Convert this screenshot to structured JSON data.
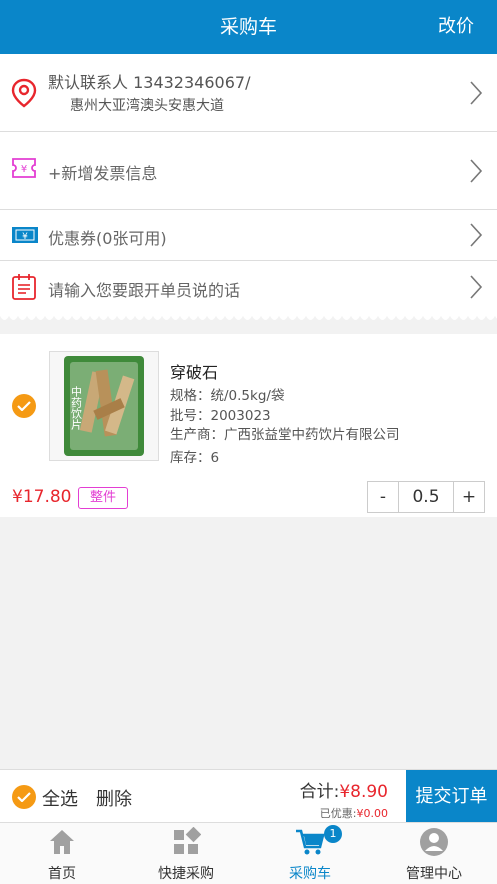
{
  "header": {
    "title": "采购车",
    "action": "改价"
  },
  "address": {
    "contact": "默认联系人 13432346067/",
    "street": "惠州大亚湾澳头安惠大道"
  },
  "invoice": {
    "label": "+新增发票信息"
  },
  "coupon": {
    "label": "优惠券(0张可用)"
  },
  "message": {
    "placeholder": "请输入您要跟开单员说的话"
  },
  "product": {
    "name": "穿破石",
    "spec": "规格：统/0.5kg/袋",
    "batch": "批号：2003023",
    "maker": "生产商：广西张益堂中药饮片有限公司",
    "stock": "库存：6",
    "price": "¥17.80",
    "tag": "整件",
    "qty": "0.5",
    "minus": "-",
    "plus": "+",
    "package_text": "中药饮片"
  },
  "footer": {
    "select_all": "全选",
    "delete": "删除",
    "total_label": "合计:",
    "total_value": "¥8.90",
    "discount_label": "已优惠:",
    "discount_value": "¥0.00",
    "submit": "提交订单"
  },
  "tabs": [
    {
      "label": "首页"
    },
    {
      "label": "快捷采购"
    },
    {
      "label": "采购车",
      "badge": "1"
    },
    {
      "label": "管理中心"
    }
  ],
  "colors": {
    "primary": "#0a86c9",
    "price": "#e8262d",
    "check": "#f59a14",
    "tag": "#e33ed3"
  }
}
